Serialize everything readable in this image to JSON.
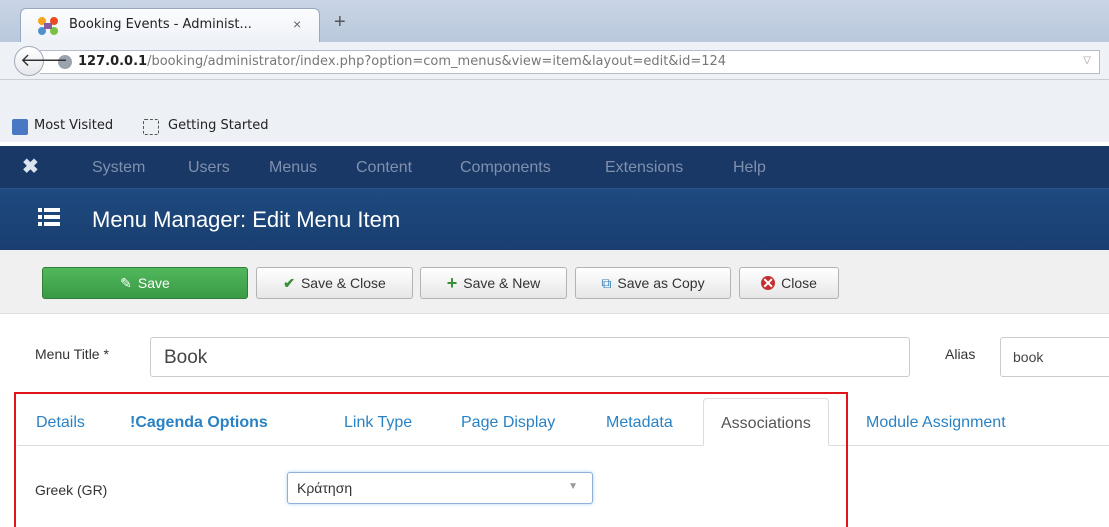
{
  "browser": {
    "tab_title": "Booking Events - Administ...",
    "tab_close": "×",
    "new_tab": "+",
    "url_host": "127.0.0.1",
    "url_path": "/booking/administrator/index.php?option=com_menus&view=item&layout=edit&id=124",
    "bookmarks": [
      "Most Visited",
      "Getting Started"
    ]
  },
  "topnav": {
    "items": [
      "System",
      "Users",
      "Menus",
      "Content",
      "Components",
      "Extensions",
      "Help"
    ]
  },
  "header": {
    "title": "Menu Manager: Edit Menu Item"
  },
  "toolbar": {
    "save": "Save",
    "save_close": "Save & Close",
    "save_new": "Save & New",
    "save_copy": "Save as Copy",
    "close": "Close"
  },
  "form": {
    "menu_title_label": "Menu Title *",
    "menu_title_value": "Book",
    "alias_label": "Alias",
    "alias_value": "book"
  },
  "tabs": [
    "Details",
    "!Cagenda Options",
    "Link Type",
    "Page Display",
    "Metadata",
    "Associations",
    "Module Assignment"
  ],
  "associations": {
    "language_label": "Greek (GR)",
    "selected": "Κράτηση"
  },
  "colors": {
    "navbar": "#1a3866",
    "header": "#1e4a80",
    "save_button": "#46a94f",
    "highlight": "#e0141b",
    "tab_link": "#2a82c4"
  }
}
